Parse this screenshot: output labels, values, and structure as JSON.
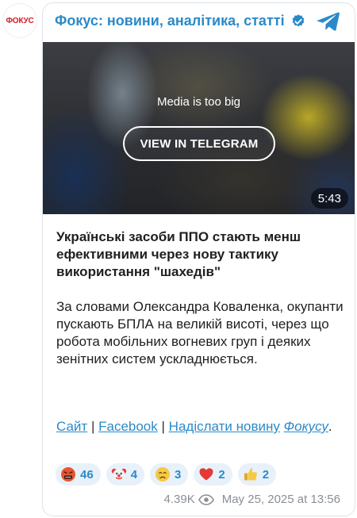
{
  "avatar": {
    "text": "ФОКУС"
  },
  "header": {
    "channel_name": "Фокус: новини, аналітика, статті"
  },
  "media": {
    "message": "Media is too big",
    "button_label": "VIEW IN TELEGRAM",
    "duration": "5:43"
  },
  "post": {
    "headline": "Українські засоби ППО стають менш ефективними через нову тактику використання \"шахедів\"",
    "lede": "За словами Олександра Коваленка, окупанти пускають БПЛА на великій висоті, через що робота мобільних вогневих груп і деяких зенітних систем ускладнюється."
  },
  "links": {
    "site": "Сайт",
    "separator": "|",
    "facebook": "Facebook",
    "send_news": "Надіслати новину",
    "brand": "Фокусу",
    "end": "."
  },
  "reactions": [
    {
      "emoji": "angry-cursing-face",
      "count": "46"
    },
    {
      "emoji": "clown-face",
      "count": "4"
    },
    {
      "emoji": "crying-face",
      "count": "3"
    },
    {
      "emoji": "red-heart",
      "count": "2"
    },
    {
      "emoji": "thumbs-up",
      "count": "2"
    }
  ],
  "meta": {
    "views": "4.39K",
    "date": "May 25, 2025 at 13:56"
  },
  "colors": {
    "accent": "#2a8ac9",
    "brand_red": "#d81b23",
    "reaction_bg": "#e8f1f9",
    "meta_gray": "#8a8f95"
  }
}
